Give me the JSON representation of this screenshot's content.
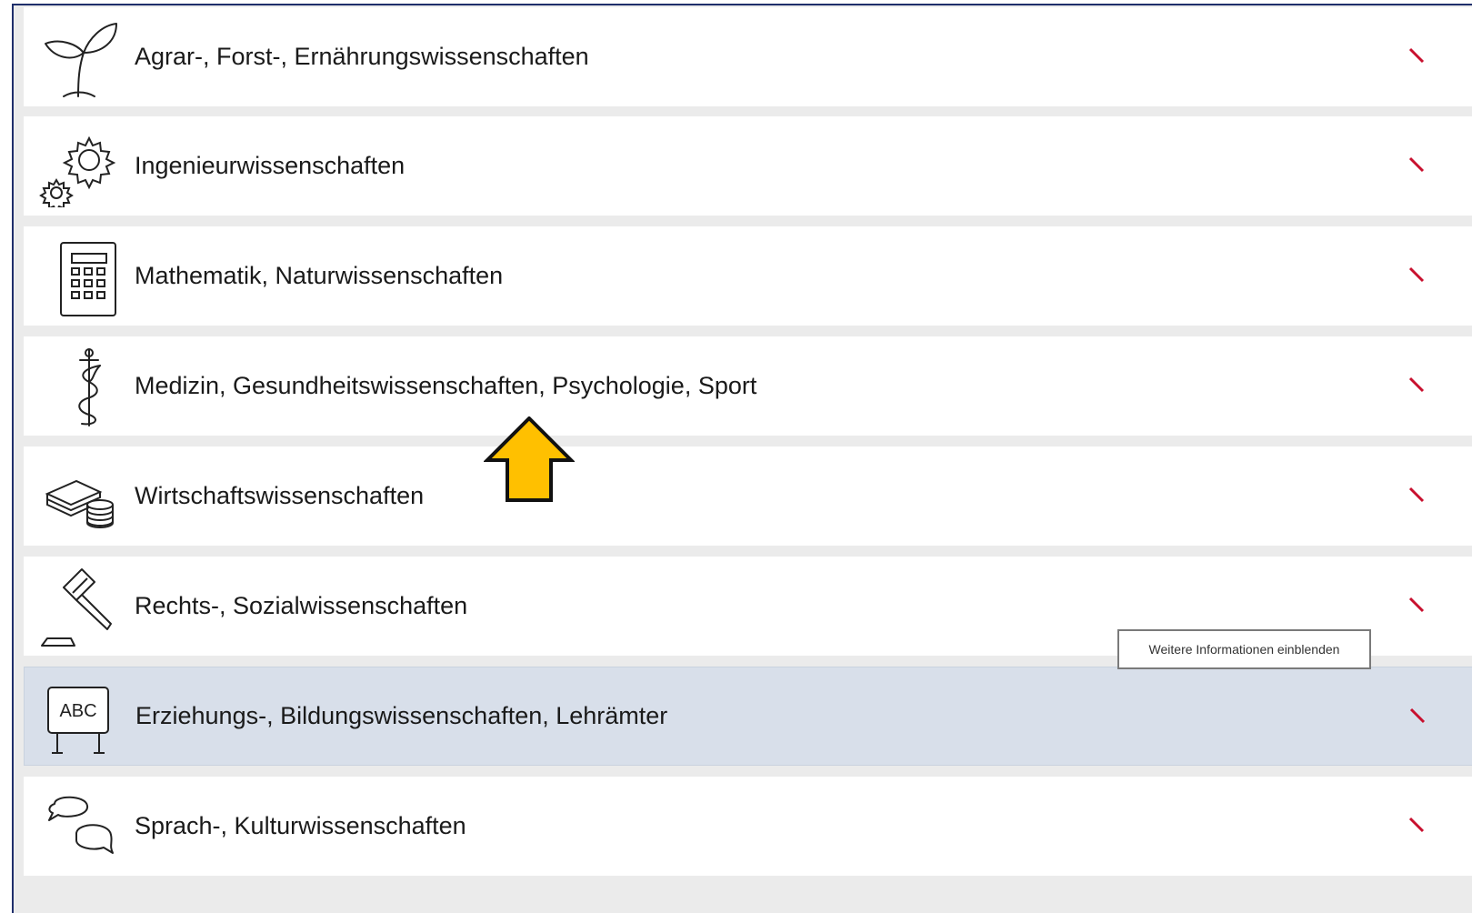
{
  "categories": [
    {
      "label": "Agrar-, Forst-, Ernährungswissenschaften",
      "icon": "plant-icon"
    },
    {
      "label": "Ingenieurwissenschaften",
      "icon": "gears-icon"
    },
    {
      "label": "Mathematik, Naturwissenschaften",
      "icon": "calculator-icon"
    },
    {
      "label": "Medizin, Gesundheitswissenschaften, Psychologie, Sport",
      "icon": "caduceus-icon"
    },
    {
      "label": "Wirtschaftswissenschaften",
      "icon": "money-icon"
    },
    {
      "label": "Rechts-, Sozialwissenschaften",
      "icon": "gavel-icon"
    },
    {
      "label": "Erziehungs-, Bildungswissenschaften, Lehrämter",
      "icon": "blackboard-abc-icon",
      "highlighted": true
    },
    {
      "label": "Sprach-, Kulturwissenschaften",
      "icon": "speech-bubbles-icon"
    }
  ],
  "calculator_icon_text": "",
  "blackboard_text": "ABC",
  "tooltip": {
    "text": "Weitere Informationen einblenden"
  },
  "colors": {
    "chevron": "#c8102e",
    "highlight": "#d8dfea",
    "frame_border": "#1f2f6b",
    "arrow_fill": "#ffc000"
  }
}
